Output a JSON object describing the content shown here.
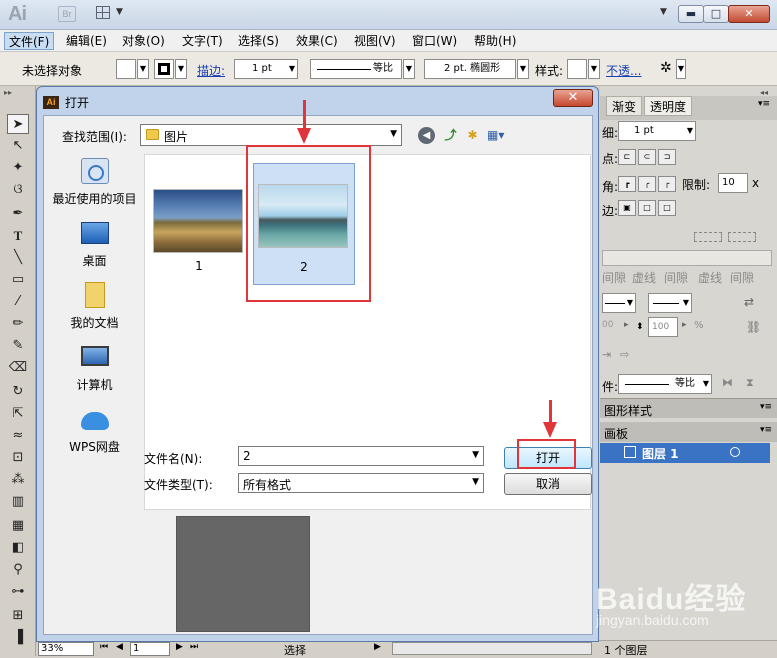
{
  "app": {
    "logo": "Ai",
    "bridge_badge": "Br",
    "window_buttons": {
      "minimize": "▬",
      "maximize": "□",
      "close": "✕"
    }
  },
  "menubar": {
    "items": [
      "文件(F)",
      "编辑(E)",
      "对象(O)",
      "文字(T)",
      "选择(S)",
      "效果(C)",
      "视图(V)",
      "窗口(W)",
      "帮助(H)"
    ]
  },
  "controlbar": {
    "selection_status": "未选择对象",
    "stroke_label": "描边:",
    "stroke_weight": "1 pt",
    "stroke_profile": "等比",
    "brush": "2 pt. 椭圆形",
    "style_label": "样式:",
    "opacity_link": "不透..."
  },
  "dialog": {
    "title": "打开",
    "close_symbol": "✕",
    "look_in_label": "查找范围(I):",
    "look_in_value": "图片",
    "places": [
      "最近使用的项目",
      "桌面",
      "我的文档",
      "计算机",
      "WPS网盘"
    ],
    "files": [
      {
        "name": "1",
        "selected": false
      },
      {
        "name": "2",
        "selected": true
      }
    ],
    "filename_label": "文件名(N):",
    "filename_value": "2",
    "filetype_label": "文件类型(T):",
    "filetype_value": "所有格式",
    "open_button": "打开",
    "cancel_button": "取消",
    "annotation_color": "#e0353a"
  },
  "right_panel": {
    "tabs": [
      "渐变",
      "透明度"
    ],
    "weight_value": "1 pt",
    "limit_label": "限制:",
    "limit_value": "10",
    "x_symbol": "x",
    "row_labels": [
      "细:",
      "点:",
      "角:",
      "边:"
    ],
    "dash_labels": [
      "间隙",
      "虚线",
      "间隙",
      "虚线",
      "间隙"
    ],
    "percent_value": "100",
    "percent_sign": "%",
    "profile_label": "件:",
    "profile_value": "等比",
    "graphic_styles_tab": "图形样式",
    "layers_tab": "画板",
    "layer_name": "图层 1",
    "layer_count": "1 个图层"
  },
  "statusbar": {
    "zoom": "33%",
    "page": "1",
    "tool": "选择"
  },
  "watermark": {
    "brand": "Baidu经验",
    "url": "jingyan.baidu.com"
  }
}
